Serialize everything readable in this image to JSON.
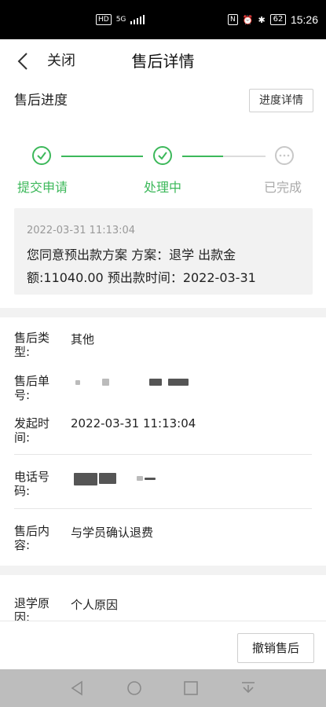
{
  "status_bar": {
    "left_icons": [
      "hd-icon",
      "signal-5g-icon",
      "wifi-signal-icon"
    ],
    "right_icons": [
      "nfc-icon",
      "alarm-icon",
      "bluetooth-icon"
    ],
    "battery": "62",
    "time": "15:26"
  },
  "nav": {
    "close_label": "关闭",
    "title": "售后详情"
  },
  "progress": {
    "heading": "售后进度",
    "detail_button": "进度详情",
    "steps": [
      {
        "label": "提交申请",
        "state": "done"
      },
      {
        "label": "处理中",
        "state": "done"
      },
      {
        "label": "已完成",
        "state": "pending"
      }
    ],
    "accent": "#3cb85a"
  },
  "message": {
    "time": "2022-03-31 11:13:04",
    "line1": "您同意预出款方案 方案：退学 出款金",
    "line2": "额:11040.00 预出款时间：2022-03-31"
  },
  "details": [
    {
      "label1": "售后类",
      "label2": "型:",
      "value": "其他"
    },
    {
      "label1": "售后单",
      "label2": "号:",
      "value": ""
    },
    {
      "label1": "发起时",
      "label2": "间:",
      "value": "2022-03-31 11:13:04"
    },
    {
      "label1": "电话号",
      "label2": "码:",
      "value": ""
    },
    {
      "label1": "售后内",
      "label2": "容:",
      "value": "与学员确认退费"
    },
    {
      "label1": "退学原",
      "label2": "因:",
      "value": "个人原因"
    }
  ],
  "footer": {
    "cancel_button": "撤销售后"
  },
  "system_nav": [
    "back-triangle-icon",
    "home-circle-icon",
    "recents-square-icon",
    "notification-down-icon"
  ]
}
